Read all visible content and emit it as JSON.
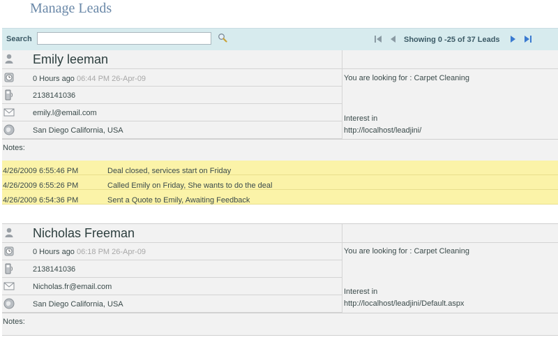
{
  "page": {
    "title": "Manage Leads"
  },
  "search": {
    "label": "Search",
    "value": "",
    "placeholder": ""
  },
  "pager": {
    "status": "Showing 0 -25 of 37 Leads"
  },
  "leads": [
    {
      "name": "Emily leeman",
      "time_ago": "0 Hours ago",
      "timestamp": "06:44 PM 26-Apr-09",
      "phone": "2138141036",
      "email": "emily.l@email.com",
      "location": "San Diego California, USA",
      "looking_for": "You are looking for : Carpet Cleaning",
      "interest_label": "Interest in",
      "interest_url": "http://localhost/leadjini/",
      "notes_label": "Notes:",
      "notes": [
        {
          "time": "4/26/2009 6:55:46 PM",
          "text": "Deal closed, services start on Friday"
        },
        {
          "time": "4/26/2009 6:55:26 PM",
          "text": "Called Emily on Friday, She wants to do the deal"
        },
        {
          "time": "4/26/2009 6:54:36 PM",
          "text": "Sent a Quote to Emily, Awaiting Feedback"
        }
      ]
    },
    {
      "name": "Nicholas Freeman",
      "time_ago": "0 Hours ago",
      "timestamp": "06:18 PM 26-Apr-09",
      "phone": "2138141036",
      "email": "Nicholas.fr@email.com",
      "location": "San Diego California, USA",
      "looking_for": "You are looking for : Carpet Cleaning",
      "interest_label": "Interest in",
      "interest_url": "http://localhost/leadjini/Default.aspx",
      "notes_label": "Notes:"
    }
  ]
}
